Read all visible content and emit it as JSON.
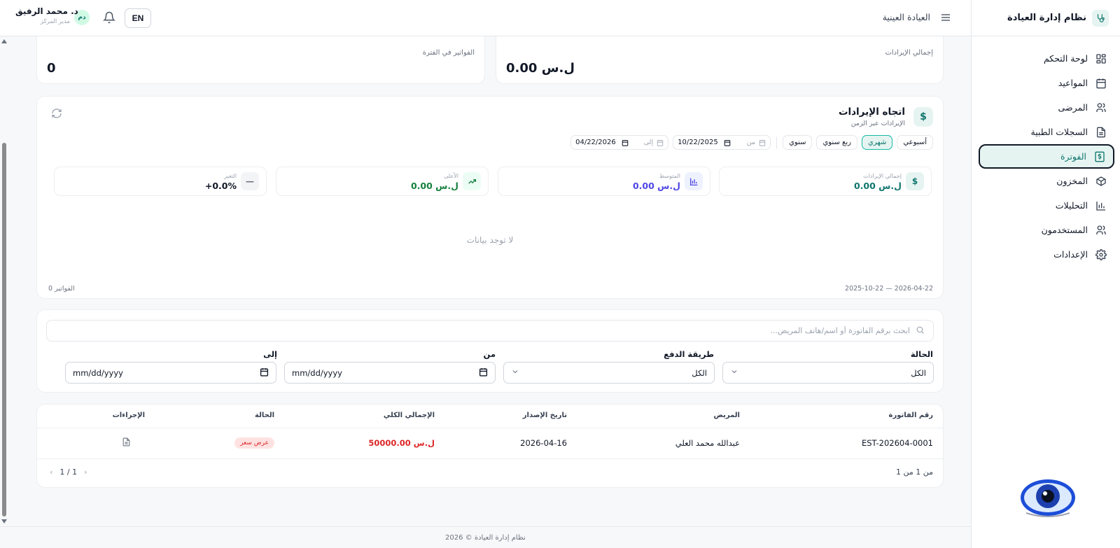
{
  "app": {
    "title": "نظام إدارة العيادة"
  },
  "sidebar": {
    "items": [
      {
        "label": "لوحة التحكم",
        "icon": "dashboard-icon"
      },
      {
        "label": "المواعيد",
        "icon": "calendar-icon"
      },
      {
        "label": "المرضى",
        "icon": "users-icon"
      },
      {
        "label": "السجلات الطبية",
        "icon": "file-icon"
      },
      {
        "label": "الفوترة",
        "icon": "dollar-icon",
        "active": true
      },
      {
        "label": "المخزون",
        "icon": "box-icon"
      },
      {
        "label": "التحليلات",
        "icon": "bar-chart-icon"
      },
      {
        "label": "المستخدمون",
        "icon": "users-icon"
      },
      {
        "label": "الإعدادات",
        "icon": "gear-icon"
      }
    ]
  },
  "topbar": {
    "clinic": "العيادة العينية",
    "lang": "EN",
    "avatar_initials": "دم",
    "user_name": "د. محمد الرفيق",
    "user_role": "مدير المركز"
  },
  "stats_top": {
    "revenue_label": "إجمالي الإيرادات",
    "revenue_value": "ل.س 0.00",
    "invoices_label": "الفواتير في الفترة",
    "invoices_value": "0"
  },
  "revenue": {
    "title": "اتجاه الإيرادات",
    "subtitle": "الإيرادات عبر الزمن",
    "periods": [
      "أسبوعي",
      "شهري",
      "ربع سنوي",
      "سنوي"
    ],
    "active_period": "شهري",
    "from_label": "من",
    "from_date": "10/22/2025",
    "to_label": "إلى",
    "to_date": "04/22/2026",
    "cards": {
      "total": {
        "label": "إجمالي الإيرادات",
        "value": "ل.س 0.00"
      },
      "avg": {
        "label": "المتوسط",
        "value": "ل.س 0.00"
      },
      "max": {
        "label": "الأعلى",
        "value": "ل.س 0.00"
      },
      "change": {
        "label": "التغير",
        "value": "+0.0%"
      }
    },
    "empty": "لا توجد بيانات",
    "range": "2025-10-22 — 2026-04-22",
    "count": "0 الفواتير"
  },
  "filters": {
    "search_placeholder": "ابحث برقم الفاتورة أو اسم/هاتف المريض...",
    "status_label": "الحالة",
    "status_value": "الكل",
    "payment_label": "طريقة الدفع",
    "payment_value": "الكل",
    "from_label": "من",
    "from_value": "mm/dd/yyyy",
    "to_label": "إلى",
    "to_value": "mm/dd/yyyy"
  },
  "table": {
    "headers": {
      "number": "رقم الفاتورة",
      "patient": "المريض",
      "date": "تاريخ الإصدار",
      "total": "الإجمالي الكلي",
      "status": "الحالة",
      "actions": "الإجراءات"
    },
    "rows": [
      {
        "number": "EST-202604-0001",
        "patient": "عبدالله محمد العلي",
        "date": "2026-04-16",
        "total": "50000.00 ل.س",
        "status": "عرض سعر"
      }
    ],
    "pager_summary": "من 1 من 1",
    "pager_page": "1 / 1"
  },
  "footer": {
    "text": "نظام إدارة العيادة © 2026"
  },
  "colors": {
    "accent": "#0f766e",
    "accent_bg": "#e6f4f1",
    "danger": "#dc2626",
    "purple": "#4f46e5",
    "green": "#15803d"
  }
}
